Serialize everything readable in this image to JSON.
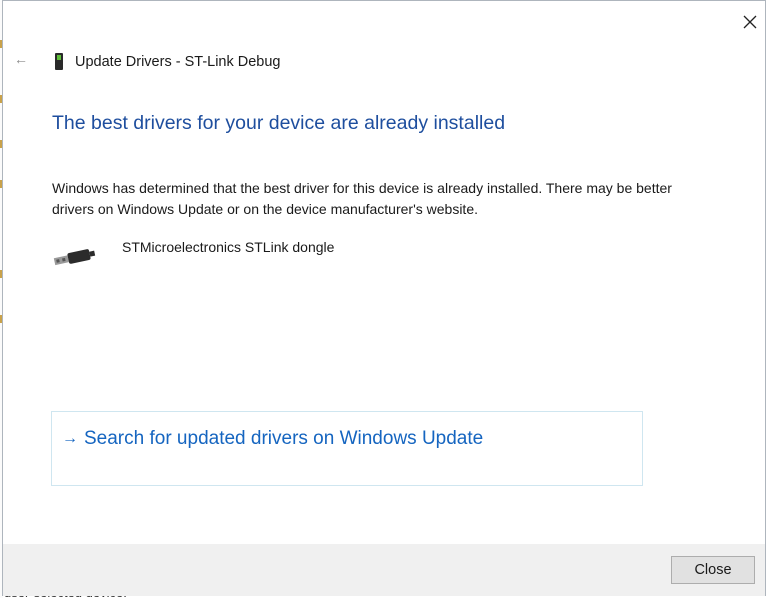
{
  "window": {
    "title": "Update Drivers - ST-Link Debug",
    "close_icon": "close-icon",
    "back_icon": "back-arrow-icon"
  },
  "main": {
    "heading": "The best drivers for your device are already installed",
    "description": "Windows has determined that the best driver for this device is already installed. There may be better drivers on Windows Update or on the device manufacturer's website.",
    "device_name": "STMicroelectronics STLink dongle",
    "device_icon": "usb-plug-icon"
  },
  "search_link": {
    "arrow": "→",
    "label": "Search for updated drivers on Windows Update"
  },
  "footer": {
    "close_label": "Close"
  },
  "background_window": {
    "partial_text": "user-selected device."
  },
  "colors": {
    "heading": "#1e4e9e",
    "link": "#1565c0",
    "footer_bg": "#f0f0f0",
    "link_border": "#cfe6f0"
  }
}
